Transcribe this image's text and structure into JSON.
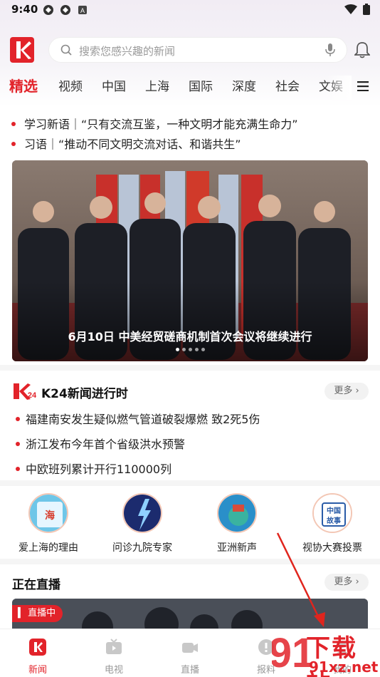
{
  "status_bar": {
    "time": "9:40"
  },
  "search": {
    "placeholder": "搜索您感兴趣的新闻"
  },
  "tabs": [
    {
      "label": "精选",
      "active": true
    },
    {
      "label": "视频"
    },
    {
      "label": "中国"
    },
    {
      "label": "上海"
    },
    {
      "label": "国际"
    },
    {
      "label": "深度"
    },
    {
      "label": "社会"
    },
    {
      "label": "文娱"
    }
  ],
  "headlines": [
    "学习新语｜“只有交流互鉴，一种文明才能充满生命力”",
    "习语｜“推动不同文明交流对话、和谐共生”"
  ],
  "hero": {
    "caption": "6月10日 中美经贸磋商机制首次会议将继续进行",
    "slide_count": 5,
    "active_slide": 1
  },
  "k24": {
    "title": "K24新闻进行时",
    "more": "更多",
    "items": [
      "福建南安发生疑似燃气管道破裂爆燃 致2死5伤",
      "浙江发布今年首个省级洪水预警",
      "中欧班列累计开行110000列"
    ]
  },
  "shortcuts": [
    {
      "label": "爱上海的理由",
      "icon": "love-shanghai-icon"
    },
    {
      "label": "问诊九院专家",
      "icon": "lightning-doctor-icon"
    },
    {
      "label": "亚洲新声",
      "icon": "asia-voice-icon"
    },
    {
      "label": "视协大赛投票",
      "icon": "china-story-icon"
    }
  ],
  "live": {
    "title": "正在直播",
    "more": "更多",
    "badge": "直播中"
  },
  "bottom_nav": [
    {
      "label": "新闻",
      "active": true
    },
    {
      "label": "电视"
    },
    {
      "label": "直播"
    },
    {
      "label": "报料"
    },
    {
      "label": "我的"
    }
  ],
  "watermark": {
    "text_main": "下载站",
    "text_sub": "91xz.net"
  },
  "colors": {
    "accent": "#e2232a"
  }
}
